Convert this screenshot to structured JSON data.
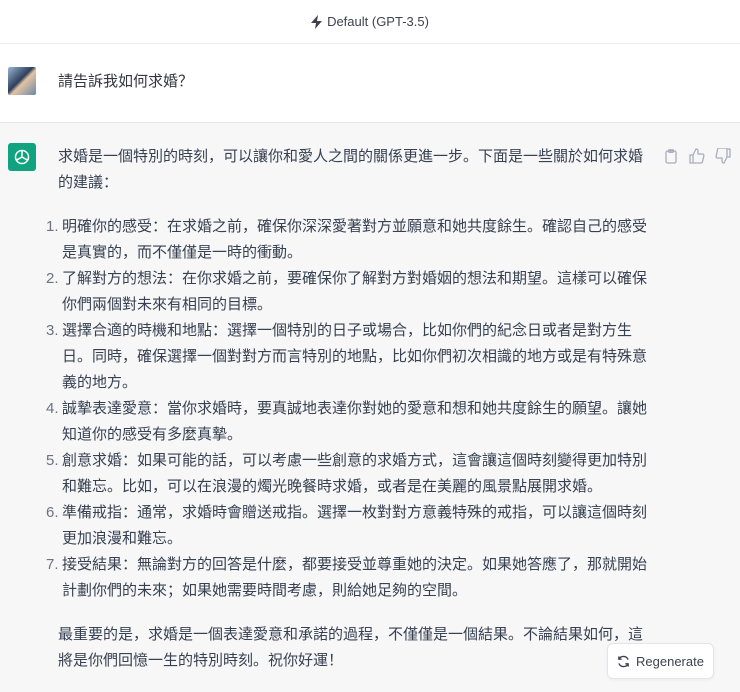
{
  "header": {
    "model": "Default (GPT-3.5)"
  },
  "user": {
    "message": "請告訴我如何求婚？"
  },
  "assistant": {
    "intro": "求婚是一個特別的時刻，可以讓你和愛人之間的關係更進一步。下面是一些關於如何求婚的建議：",
    "items": [
      {
        "num": "1.",
        "text": "明確你的感受：在求婚之前，確保你深深愛著對方並願意和她共度餘生。確認自己的感受是真實的，而不僅僅是一時的衝動。"
      },
      {
        "num": "2.",
        "text": "了解對方的想法：在你求婚之前，要確保你了解對方對婚姻的想法和期望。這樣可以確保你們兩個對未來有相同的目標。"
      },
      {
        "num": "3.",
        "text": "選擇合適的時機和地點：選擇一個特別的日子或場合，比如你們的紀念日或者是對方生日。同時，確保選擇一個對對方而言特別的地點，比如你們初次相識的地方或是有特殊意義的地方。"
      },
      {
        "num": "4.",
        "text": "誠摯表達愛意：當你求婚時，要真誠地表達你對她的愛意和想和她共度餘生的願望。讓她知道你的感受有多麼真摯。"
      },
      {
        "num": "5.",
        "text": "創意求婚：如果可能的話，可以考慮一些創意的求婚方式，這會讓這個時刻變得更加特別和難忘。比如，可以在浪漫的燭光晚餐時求婚，或者是在美麗的風景點展開求婚。"
      },
      {
        "num": "6.",
        "text": "準備戒指：通常，求婚時會贈送戒指。選擇一枚對對方意義特殊的戒指，可以讓這個時刻更加浪漫和難忘。"
      },
      {
        "num": "7.",
        "text": "接受結果：無論對方的回答是什麼，都要接受並尊重她的決定。如果她答應了，那就開始計劃你們的未來；如果她需要時間考慮，則給她足夠的空間。"
      }
    ],
    "conclusion": "最重要的是，求婚是一個表達愛意和承諾的過程，不僅僅是一個結果。不論結果如何，這將是你們回憶一生的特別時刻。祝你好運！"
  },
  "regenerate_label": "Regenerate",
  "colors": {
    "brand": "#10a37f"
  }
}
